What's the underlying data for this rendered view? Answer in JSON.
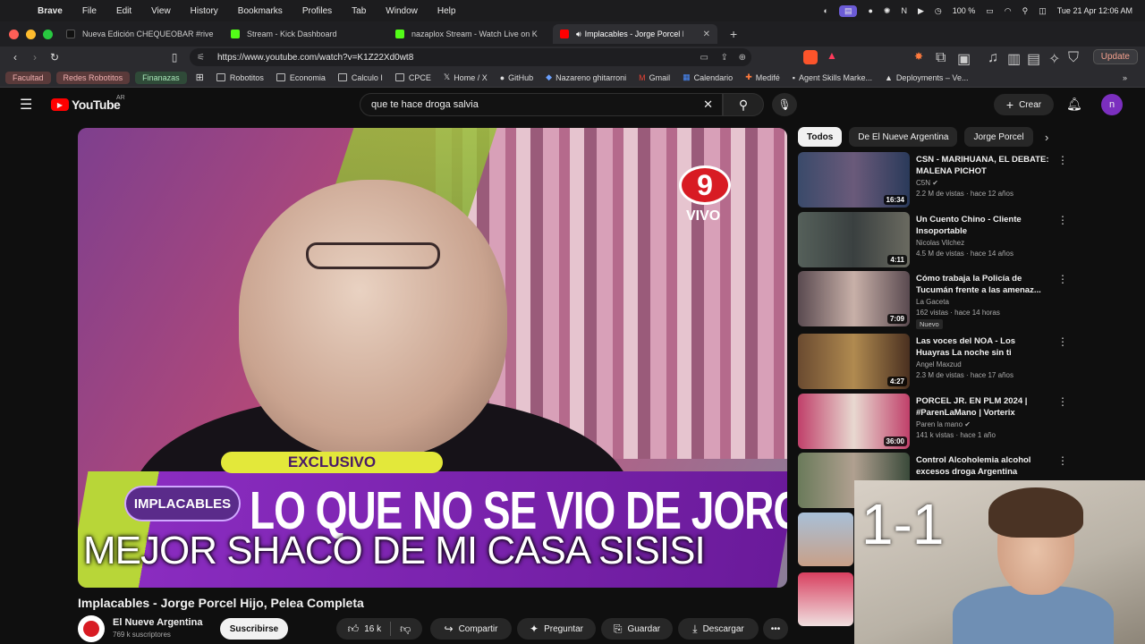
{
  "menubar": {
    "app": "Brave",
    "items": [
      "File",
      "Edit",
      "View",
      "History",
      "Bookmarks",
      "Profiles",
      "Tab",
      "Window",
      "Help"
    ],
    "battery": "100 %",
    "datetime": "Tue 21 Apr  12:06 AM"
  },
  "tabs": [
    {
      "label": "Nueva Edición CHEQUEOBAR #rive",
      "color": "#111111"
    },
    {
      "label": "Stream - Kick Dashboard",
      "color": "#53fc18"
    },
    {
      "label": "nazaplox Stream - Watch Live on K",
      "color": "#53fc18"
    },
    {
      "label": "Implacables - Jorge Porcel Hijo",
      "color": "#ff0000",
      "active": true
    }
  ],
  "address": {
    "url": "https://www.youtube.com/watch?v=K1Z22Xd0wt8"
  },
  "bookmarks": {
    "chips": [
      {
        "label": "Facultad",
        "bg": "#5a3a3a",
        "fg": "#f0b0b0"
      },
      {
        "label": "Redes Robotitos",
        "bg": "#5a3a3a",
        "fg": "#f0b0b0"
      },
      {
        "label": "Finanazas",
        "bg": "#2f4a38",
        "fg": "#a8e6b8"
      }
    ],
    "items": [
      "Robotitos",
      "Economia",
      "Calculo I",
      "CPCE",
      "Home / X",
      "GitHub",
      "Nazareno ghitarroni",
      "Gmail",
      "Calendario",
      "Medifé",
      "Agent Skills Marke...",
      "Deployments – Ve..."
    ],
    "update_label": "Update"
  },
  "youtube": {
    "logo": "YouTube",
    "region": "AR",
    "search_value": "que te hace droga salvia",
    "create_label": "Crear",
    "avatar_letter": "n"
  },
  "video": {
    "channel_badge": "9",
    "live_label": "VIVO",
    "exclusive_label": "EXCLUSIVO",
    "show_label": "IMPLACABLES",
    "headline": "LO QUE NO SE VIO DE JORGE PORCEL",
    "caption": "MEJOR SHACO DE MI CASA SISISI",
    "title": "Implacables - Jorge Porcel Hijo, Pelea Completa",
    "channel": "El Nueve Argentina",
    "subscribers": "769 k suscriptores",
    "subscribe_label": "Suscribirse",
    "likes": "16 k",
    "share_label": "Compartir",
    "ask_label": "Preguntar",
    "save_label": "Guardar",
    "download_label": "Descargar"
  },
  "filter_chips": [
    "Todos",
    "De El Nueve Argentina",
    "Jorge Porcel"
  ],
  "recommendations": [
    {
      "title": "CSN - MARIHUANA, EL DEBATE: MALENA PICHOT",
      "channel": "C5N",
      "meta": "2.2 M de vistas · hace 12 años",
      "duration": "16:34",
      "thumb": "#3a4a6a"
    },
    {
      "title": "Un Cuento Chino - Cliente Insoportable",
      "channel": "Nicolas Vilchez",
      "meta": "4.5 M de vistas · hace 14 años",
      "duration": "4:11",
      "thumb": "#556055"
    },
    {
      "title": "Cómo trabaja la Policía de Tucumán frente a las amenaz...",
      "channel": "La Gaceta",
      "meta": "162 vistas · hace 14 horas",
      "duration": "7:09",
      "thumb": "#8a6a70",
      "badge": "Nuevo"
    },
    {
      "title": "Las voces del NOA - Los Huayras   La noche sin ti",
      "channel": "Angel Maxzud",
      "meta": "2.3 M de vistas · hace 17 años",
      "duration": "4:27",
      "thumb": "#6a4a30"
    },
    {
      "title": "PORCEL JR. EN PLM 2024 | #ParenLaMano | Vorterix",
      "channel": "Paren la mano",
      "meta": "141 k vistas · hace 1 año",
      "duration": "36:00",
      "thumb": "#c0406a"
    },
    {
      "title": "Control Alcoholemia alcohol excesos droga Argentina",
      "channel": "",
      "meta": "",
      "duration": "",
      "thumb": "#6a7a5a"
    }
  ],
  "webcam": {
    "score": "1-1"
  }
}
